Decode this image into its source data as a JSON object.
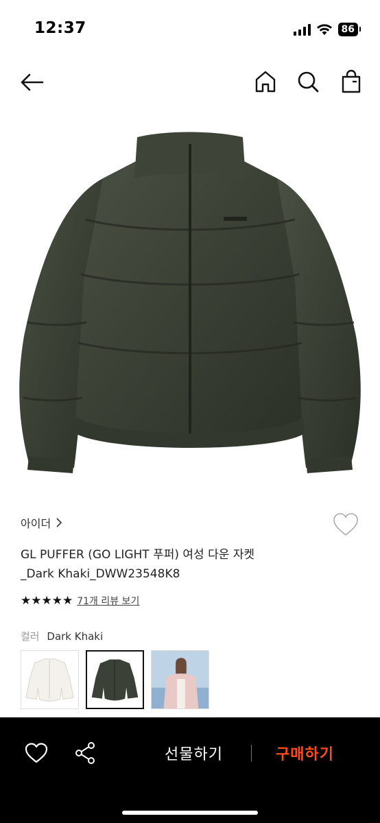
{
  "status_bar": {
    "time": "12:37",
    "battery": "86",
    "icons": [
      "signal-icon",
      "wifi-icon",
      "battery-icon"
    ]
  },
  "nav": {
    "icons": [
      "back-arrow-icon",
      "home-icon",
      "search-icon",
      "shopping-bag-icon"
    ]
  },
  "product": {
    "image_icon": "dark-khaki-puffer-jacket",
    "brand": "아이더",
    "brand_chevron": ">",
    "title_line1": "GL PUFFER (GO LIGHT 푸퍼) 여성 다운 자켓",
    "title_line2": "_Dark Khaki_DWW23548K8",
    "rating_stars": 5,
    "stars_text": "★★★★★",
    "review_link": "71개 리뷰 보기",
    "color_label": "컬러",
    "color_value": "Dark Khaki",
    "swatches": [
      {
        "name": "ivory",
        "color": "#f3f1ec",
        "selected": false
      },
      {
        "name": "dark-khaki",
        "color": "#3b4136",
        "selected": true
      },
      {
        "name": "pink-model",
        "color": "#e9c9c6",
        "selected": false
      }
    ]
  },
  "bottom_bar": {
    "gift_label": "선물하기",
    "buy_label": "구매하기",
    "buy_color": "#ff4b1a",
    "background": "#000000"
  }
}
